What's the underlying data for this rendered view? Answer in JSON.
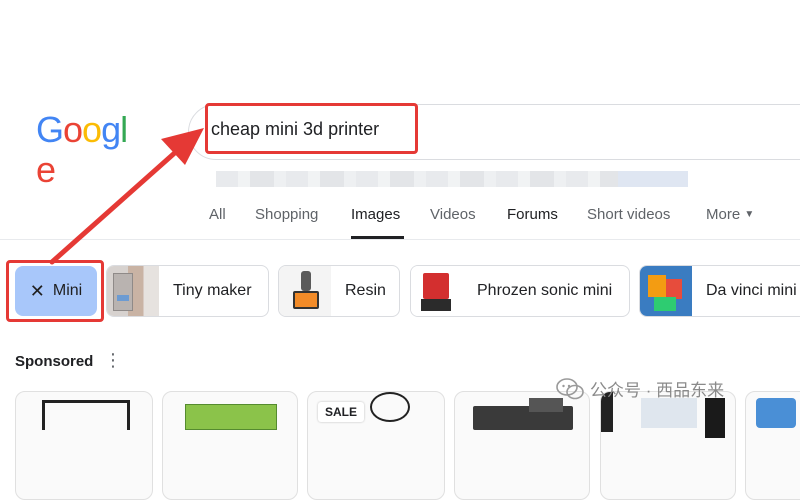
{
  "logo": {
    "text": "Google",
    "letters": [
      "G",
      "o",
      "o",
      "g",
      "l",
      "e"
    ],
    "colors": [
      "#4285F4",
      "#EA4335",
      "#FBBC05",
      "#4285F4",
      "#34A853",
      "#EA4335"
    ]
  },
  "search": {
    "query": "cheap mini 3d printer"
  },
  "tabs": [
    "All",
    "Shopping",
    "Images",
    "Videos",
    "Forums",
    "Short videos",
    "More"
  ],
  "active_tab": "Images",
  "chips": {
    "selected": {
      "label": "Mini",
      "remove_icon": "close-icon"
    },
    "items": [
      "Tiny maker",
      "Resin",
      "Phrozen sonic mini",
      "Da vinci mini"
    ]
  },
  "sponsored": {
    "label": "Sponsored",
    "sale_badge": "SALE"
  },
  "watermark": {
    "text": "公众号 · 西品东来"
  },
  "colors": {
    "highlight": "#e53935",
    "chip_selected": "#a8c7fa",
    "tab_active": "#202124"
  }
}
